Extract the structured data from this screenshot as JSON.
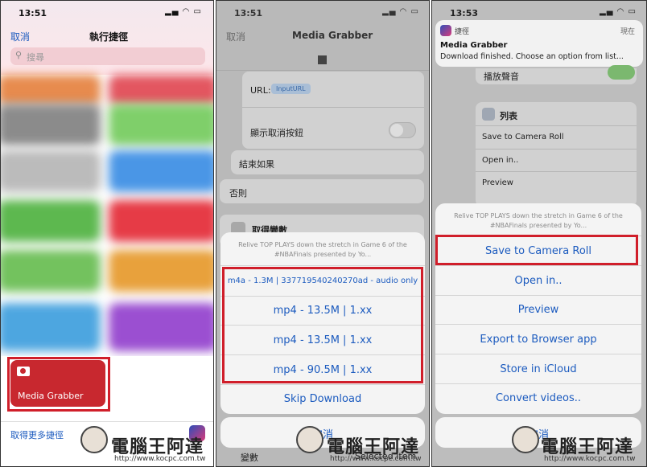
{
  "panel1": {
    "time": "13:51",
    "cancel": "取消",
    "title": "執行捷徑",
    "search_placeholder": "搜尋",
    "card_label": "Media Grabber",
    "more_link": "取得更多捷徑"
  },
  "panel2": {
    "time": "13:51",
    "cancel": "取消",
    "title": "Media Grabber",
    "url_label": "URL:",
    "url_chip": "InputURL",
    "show_cancel": "顯示取消按鈕",
    "end_if": "結束如果",
    "otherwise": "否則",
    "get_variable": "取得變數",
    "sheet_message": "Relive TOP PLAYS down the stretch in Game 6 of the #NBAFinals presented by Yo...",
    "options": [
      "m4a - 1.3M | 337719540240270ad - audio only",
      "mp4 - 13.5M | 1.xx",
      "mp4 - 13.5M | 1.xx",
      "mp4 - 90.5M | 1.xx"
    ],
    "skip": "Skip Download",
    "cancel_sheet": "取消",
    "variable": "變數",
    "selected_item": "Selected Item"
  },
  "panel3": {
    "time": "13:53",
    "notif_app": "捷徑",
    "notif_time": "現在",
    "notif_title": "Media Grabber",
    "notif_body": "Download finished. Choose an option from list...",
    "play_sound": "播放聲音",
    "list_label": "列表",
    "list_items": [
      "Save to Camera Roll",
      "Open in..",
      "Preview"
    ],
    "sheet_message": "Relive TOP PLAYS down the stretch in Game 6 of the #NBAFinals presented by Yo...",
    "options": [
      "Save to Camera Roll",
      "Open in..",
      "Preview",
      "Export to Browser app",
      "Store in iCloud",
      "Convert videos.."
    ],
    "cancel_sheet": "取消"
  },
  "watermark": {
    "text": "電腦王阿達",
    "url": "http://www.kocpc.com.tw"
  },
  "colors": {
    "ios_blue": "#1c5bbf",
    "highlight_red": "#d01e2a",
    "card_red": "#c8282f"
  }
}
